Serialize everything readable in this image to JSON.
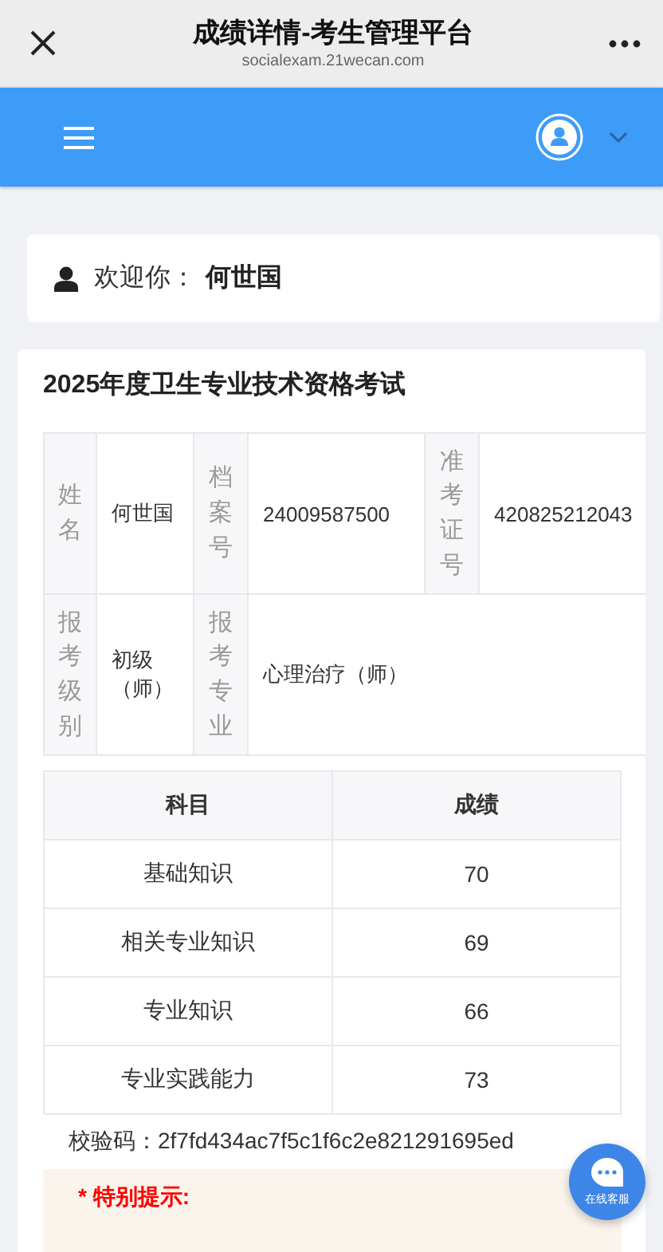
{
  "browser": {
    "title": "成绩详情-考生管理平台",
    "url": "socialexam.21wecan.com"
  },
  "welcome": {
    "label": "欢迎你：",
    "name": "何世国"
  },
  "exam": {
    "title": "2025年度卫生专业技术资格考试",
    "info_rows": [
      [
        {
          "label": "姓名",
          "value": "何世国"
        },
        {
          "label": "档案号",
          "value": "24009587500"
        },
        {
          "label": "准考证号",
          "value": "420825212043"
        }
      ],
      [
        {
          "label": "报考级别",
          "value": "初级（师）"
        },
        {
          "label": "报考专业",
          "value": "心理治疗（师）"
        }
      ]
    ],
    "scores": {
      "columns": [
        "科目",
        "成绩"
      ],
      "rows": [
        [
          "基础知识",
          "70"
        ],
        [
          "相关专业知识",
          "69"
        ],
        [
          "专业知识",
          "66"
        ],
        [
          "专业实践能力",
          "73"
        ]
      ]
    },
    "check_code": {
      "label": "校验码：",
      "value": "2f7fd434ac7f5c1f6c2e821291695ed"
    },
    "notice": {
      "title": "* 特别提示:"
    }
  },
  "chat": {
    "label": "在线客服"
  }
}
